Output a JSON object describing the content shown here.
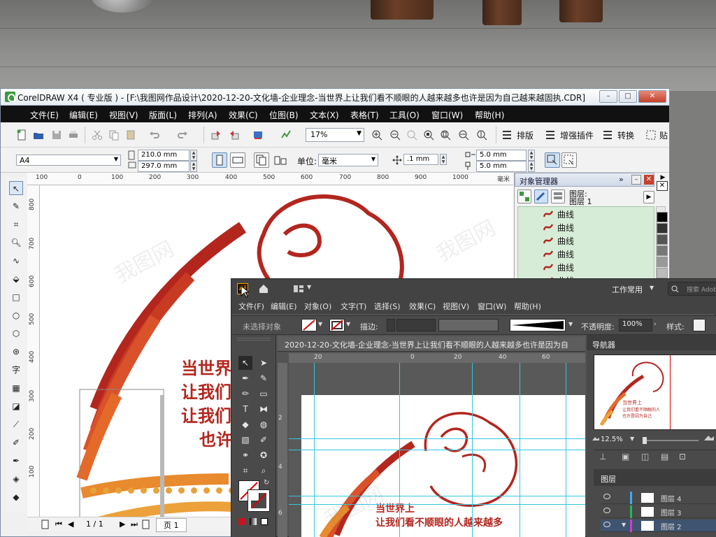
{
  "coreldraw": {
    "title": "CorelDRAW X4 ( 专业版 ) - [F:\\我图网作品设计\\2020-12-20-文化墙-企业理念-当世界上让我们看不顺眼的人越来越多也许是因为自己越来越固执.CDR]",
    "menu": [
      "文件(E)",
      "编辑(E)",
      "视图(V)",
      "版面(L)",
      "排列(A)",
      "效果(C)",
      "位图(B)",
      "文本(X)",
      "表格(T)",
      "工具(O)",
      "窗口(W)",
      "帮助(H)"
    ],
    "zoom": "17%",
    "toolbar_buttons": {
      "layout": "排版",
      "enhance": "增强插件",
      "convert": "转换",
      "paste": "贴"
    },
    "page_size": "A4",
    "width": "210.0 mm",
    "height": "297.0 mm",
    "unit_label": "单位:",
    "unit_value": "毫米",
    "nudge": ".1 mm",
    "dup_x": "5.0 mm",
    "dup_y": "5.0 mm",
    "ruler_h": [
      "100",
      "0",
      "100",
      "200",
      "300",
      "400",
      "500",
      "600",
      "700",
      "800",
      "900",
      "1000"
    ],
    "ruler_h_unit": "毫米",
    "ruler_v": [
      "800",
      "700",
      "600",
      "500",
      "400",
      "300",
      "200",
      "100"
    ],
    "canvas_text": [
      "当世界",
      "让我们",
      "让我们",
      "也许"
    ],
    "page_status": "1 / 1",
    "page_tab": "页 1",
    "object_manager": {
      "title": "对象管理器",
      "layer_labels": [
        "图层:",
        "图层 1"
      ],
      "items": [
        "曲线",
        "曲线",
        "曲线",
        "曲线",
        "曲线",
        "曲线"
      ]
    },
    "swatches": [
      "#000000",
      "#333333",
      "#555555",
      "#777777",
      "#999999",
      "#bbbbbb",
      "#dddddd"
    ]
  },
  "adobe": {
    "workspace": "工作常用",
    "search_placeholder": "搜索 Adob",
    "menu": [
      "文件(F)",
      "编辑(E)",
      "对象(O)",
      "文字(T)",
      "选择(S)",
      "效果(C)",
      "视图(V)",
      "窗口(W)",
      "帮助(H)"
    ],
    "no_selection": "未选择对象",
    "stroke_label": "描边:",
    "opacity_label": "不透明度:",
    "opacity_value": "100%",
    "style_label": "样式:",
    "document_tab": "2020-12-20-文化墙-企业理念-当世界上让我们看不顺眼的人越来越多也许是因为自",
    "ruler_h": [
      "20",
      "0",
      "20",
      "40",
      "60"
    ],
    "ruler_v": [
      "2",
      "4",
      "6"
    ],
    "artboard_text": [
      "当世界上",
      "让我们看不顺眼的人越来越多"
    ],
    "navigator": {
      "title": "导航器",
      "zoom": "12.5%"
    },
    "layers": {
      "title": "图层",
      "rows": [
        {
          "name": "图层 4",
          "color": "#3fa9f5"
        },
        {
          "name": "图层 3",
          "color": "#25b85a"
        },
        {
          "name": "图层 2",
          "color": "#d13bd1"
        }
      ]
    }
  }
}
